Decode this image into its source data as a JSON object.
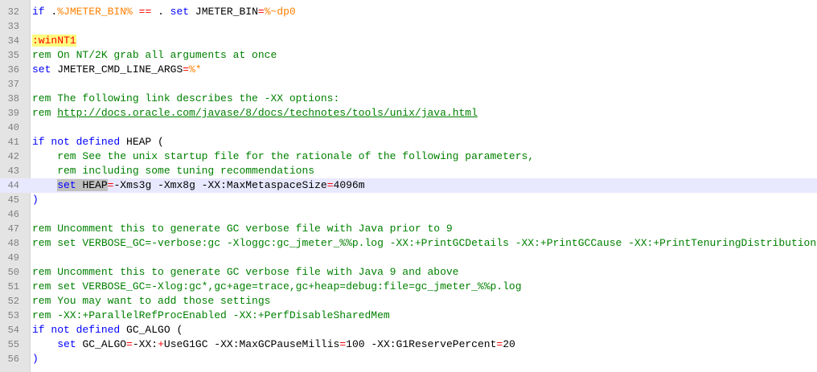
{
  "lines": [
    {
      "num": "32",
      "segs": [
        {
          "t": "if ",
          "c": "kw"
        },
        {
          "t": ".",
          "c": "tx"
        },
        {
          "t": "%JMETER_BIN%",
          "c": "var"
        },
        {
          "t": " == ",
          "c": "op"
        },
        {
          "t": ". ",
          "c": "tx"
        },
        {
          "t": "set ",
          "c": "kw"
        },
        {
          "t": "JMETER_BIN",
          "c": "tx"
        },
        {
          "t": "=",
          "c": "op"
        },
        {
          "t": "%~dp0",
          "c": "var"
        }
      ]
    },
    {
      "num": "33",
      "segs": []
    },
    {
      "num": "34",
      "segs": [
        {
          "t": ":winNT1",
          "c": "label-hl"
        }
      ]
    },
    {
      "num": "35",
      "segs": [
        {
          "t": "rem On NT/2K grab all arguments at once",
          "c": "cm"
        }
      ]
    },
    {
      "num": "36",
      "segs": [
        {
          "t": "set ",
          "c": "kw"
        },
        {
          "t": "JMETER_CMD_LINE_ARGS",
          "c": "tx"
        },
        {
          "t": "=",
          "c": "op"
        },
        {
          "t": "%*",
          "c": "var"
        }
      ]
    },
    {
      "num": "37",
      "segs": []
    },
    {
      "num": "38",
      "segs": [
        {
          "t": "rem The following link describes the -XX options:",
          "c": "cm"
        }
      ]
    },
    {
      "num": "39",
      "segs": [
        {
          "t": "rem ",
          "c": "cm"
        },
        {
          "t": "http://docs.oracle.com/javase/8/docs/technotes/tools/unix/java.html",
          "c": "lnk"
        }
      ]
    },
    {
      "num": "40",
      "segs": []
    },
    {
      "num": "41",
      "segs": [
        {
          "t": "if not defined ",
          "c": "kw"
        },
        {
          "t": "HEAP ",
          "c": "tx"
        },
        {
          "t": "(",
          "c": "tx"
        }
      ]
    },
    {
      "num": "42",
      "segs": [
        {
          "t": "    rem See the unix startup file for the rationale of the following parameters,",
          "c": "cm"
        }
      ]
    },
    {
      "num": "43",
      "segs": [
        {
          "t": "    rem including some tuning recommendations",
          "c": "cm"
        }
      ]
    },
    {
      "num": "44",
      "current": true,
      "segs": [
        {
          "t": "    ",
          "c": "tx"
        },
        {
          "t": "set",
          "c": "kw sel"
        },
        {
          "t": " ",
          "c": "tx sel"
        },
        {
          "t": "HEAP",
          "c": "tx sel"
        },
        {
          "t": "=",
          "c": "op"
        },
        {
          "t": "-Xms3g -Xmx8g -XX:MaxMetaspaceSize",
          "c": "tx"
        },
        {
          "t": "=",
          "c": "op"
        },
        {
          "t": "4096m",
          "c": "tx"
        }
      ]
    },
    {
      "num": "45",
      "segs": [
        {
          "t": ")",
          "c": "paren"
        }
      ]
    },
    {
      "num": "46",
      "segs": []
    },
    {
      "num": "47",
      "segs": [
        {
          "t": "rem Uncomment this to generate GC verbose file with Java prior to 9",
          "c": "cm"
        }
      ]
    },
    {
      "num": "48",
      "segs": [
        {
          "t": "rem set VERBOSE_GC=-verbose:gc -Xloggc:gc_jmeter_%%p.log -XX:+PrintGCDetails -XX:+PrintGCCause -XX:+PrintTenuringDistribution -XX:+PrintHeapAtGC -XX:+PrintGCApplicationConcurrentTime",
          "c": "cm"
        }
      ]
    },
    {
      "num": "49",
      "segs": []
    },
    {
      "num": "50",
      "segs": [
        {
          "t": "rem Uncomment this to generate GC verbose file with Java 9 and above",
          "c": "cm"
        }
      ]
    },
    {
      "num": "51",
      "segs": [
        {
          "t": "rem set VERBOSE_GC=-Xlog:gc*,gc+age=trace,gc+heap=debug:file=gc_jmeter_%%p.log",
          "c": "cm"
        }
      ]
    },
    {
      "num": "52",
      "segs": [
        {
          "t": "rem You may want to add those settings",
          "c": "cm"
        }
      ]
    },
    {
      "num": "53",
      "segs": [
        {
          "t": "rem -XX:+ParallelRefProcEnabled -XX:+PerfDisableSharedMem",
          "c": "cm"
        }
      ]
    },
    {
      "num": "54",
      "segs": [
        {
          "t": "if not defined ",
          "c": "kw"
        },
        {
          "t": "GC_ALGO ",
          "c": "tx"
        },
        {
          "t": "(",
          "c": "tx"
        }
      ]
    },
    {
      "num": "55",
      "segs": [
        {
          "t": "    ",
          "c": "tx"
        },
        {
          "t": "set ",
          "c": "kw"
        },
        {
          "t": "GC_ALGO",
          "c": "tx"
        },
        {
          "t": "=",
          "c": "op"
        },
        {
          "t": "-XX:",
          "c": "tx"
        },
        {
          "t": "+",
          "c": "op"
        },
        {
          "t": "UseG1GC -XX:MaxGCPauseMillis",
          "c": "tx"
        },
        {
          "t": "=",
          "c": "op"
        },
        {
          "t": "100 -XX:G1ReservePercent",
          "c": "tx"
        },
        {
          "t": "=",
          "c": "op"
        },
        {
          "t": "20",
          "c": "tx"
        }
      ]
    },
    {
      "num": "56",
      "segs": [
        {
          "t": ")",
          "c": "paren"
        }
      ]
    }
  ]
}
